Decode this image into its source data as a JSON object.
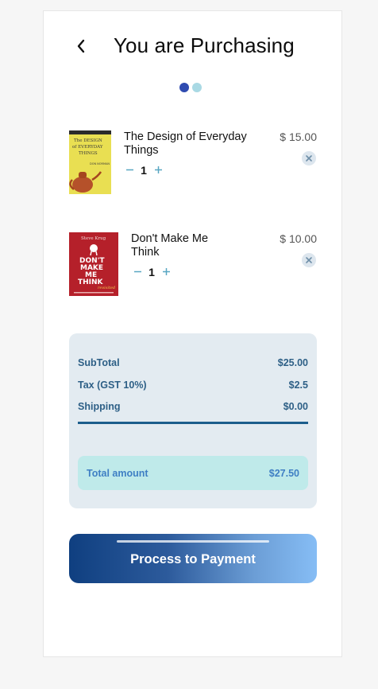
{
  "header": {
    "title": "You are Purchasing",
    "back_icon": "chevron-left-icon"
  },
  "stepper": {
    "total_steps": 2,
    "current_step": 1,
    "active_color": "#2f4bb0",
    "inactive_color": "#a9d9e4"
  },
  "cart": {
    "items": [
      {
        "title": "The Design of Everyday Things",
        "quantity": "1",
        "price": "$ 15.00",
        "decrement_icon": "minus-icon",
        "increment_icon": "plus-icon",
        "remove_icon": "close-icon",
        "cover": {
          "title_line1": "The DESIGN",
          "title_line2": "of EVERYDAY",
          "title_line3": "THINGS",
          "author": "DON NORMAN",
          "background": "#e9df52"
        }
      },
      {
        "title": "Don't Make Me Think",
        "quantity": "1",
        "price": "$ 10.00",
        "decrement_icon": "minus-icon",
        "increment_icon": "plus-icon",
        "remove_icon": "close-icon",
        "cover": {
          "author": "Steve Krug",
          "title_line1": "DON'T",
          "title_line2": "MAKE",
          "title_line3": "ME",
          "title_line4": "THINK",
          "tag": "revisited",
          "background": "#b5202a"
        }
      }
    ]
  },
  "summary": {
    "subtotal_label": "SubTotal",
    "subtotal_value": "$25.00",
    "tax_label": "Tax (GST 10%)",
    "tax_value": "$2.5",
    "shipping_label": "Shipping",
    "shipping_value": "$0.00",
    "total_label": "Total amount",
    "total_value": "$27.50"
  },
  "actions": {
    "pay_label": "Process to Payment"
  },
  "colors": {
    "summary_bg": "#e3ebf1",
    "summary_text": "#2d5f86",
    "total_bg": "#bfeaea",
    "total_text": "#3f7fc4",
    "pay_gradient_start": "#0f3f80",
    "pay_gradient_end": "#86bdf5"
  }
}
